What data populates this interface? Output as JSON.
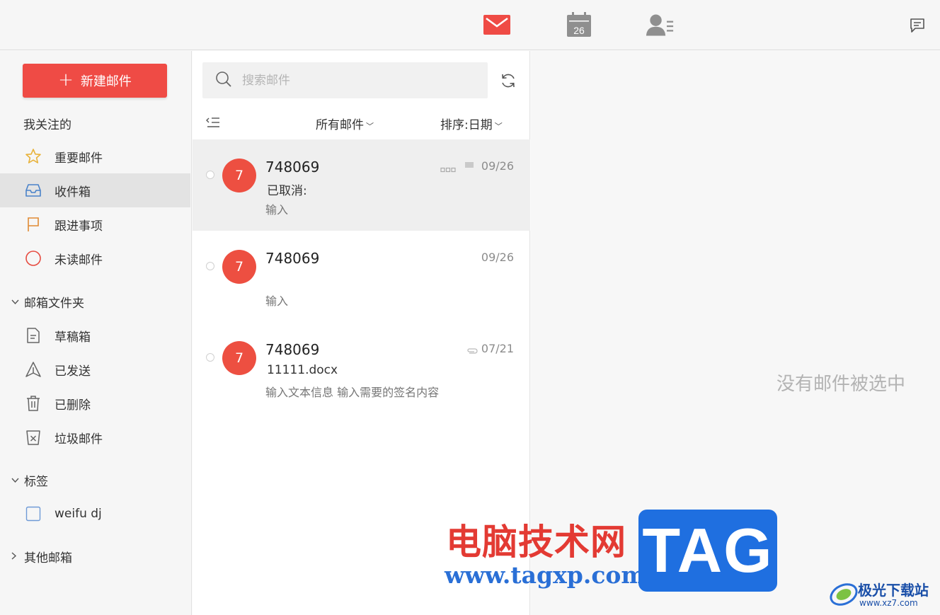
{
  "topbar": {
    "icons": [
      "mail-icon",
      "calendar-icon",
      "contacts-icon",
      "chat-icon"
    ],
    "calendar_day": "26",
    "accent": "#ef4b45"
  },
  "sidebar": {
    "compose_label": "新建邮件",
    "favorites_title": "我关注的",
    "favorites": [
      {
        "label": "重要邮件",
        "icon": "star-icon"
      },
      {
        "label": "收件箱",
        "icon": "inbox-icon"
      },
      {
        "label": "跟进事项",
        "icon": "flag-icon"
      },
      {
        "label": "未读邮件",
        "icon": "circle-icon"
      }
    ],
    "folders_title": "邮箱文件夹",
    "folders": [
      {
        "label": "草稿箱",
        "icon": "draft-icon"
      },
      {
        "label": "已发送",
        "icon": "sent-icon"
      },
      {
        "label": "已删除",
        "icon": "trash-icon"
      },
      {
        "label": "垃圾邮件",
        "icon": "spam-icon"
      }
    ],
    "tags_title": "标签",
    "tags": [
      {
        "label": "weifu dj",
        "icon": "checkbox-icon"
      }
    ],
    "other_title": "其他邮箱"
  },
  "list": {
    "search_placeholder": "搜索邮件",
    "filter_label": "所有邮件",
    "sort_label": "排序:日期",
    "mails": [
      {
        "avatar": "7",
        "sender": "748069",
        "subject": "已取消:",
        "preview": "输入",
        "date": "09/26",
        "selected": true
      },
      {
        "avatar": "7",
        "sender": "748069",
        "subject": "",
        "preview": "输入",
        "date": "09/26",
        "selected": false
      },
      {
        "avatar": "7",
        "sender": "748069",
        "subject": "11111.docx",
        "preview": "输入文本信息 输入需要的签名内容",
        "date": "07/21",
        "selected": false
      }
    ]
  },
  "reading": {
    "empty_text": "没有邮件被选中"
  },
  "watermark": {
    "title": "电脑技术网",
    "url": "www.tagxp.com",
    "tag": "TAG",
    "site_name": "极光下载站",
    "site_url": "www.xz7.com"
  }
}
